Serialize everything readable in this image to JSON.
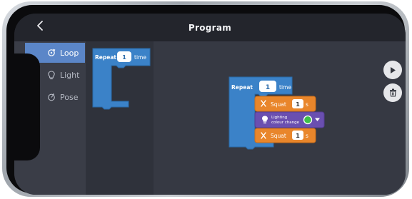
{
  "header": {
    "title": "Program",
    "back_icon": "chevron-left-icon"
  },
  "sidebar": {
    "items": [
      {
        "label": "Loop",
        "icon": "loop-icon",
        "active": true
      },
      {
        "label": "Light",
        "icon": "lightbulb-icon",
        "active": false
      },
      {
        "label": "Pose",
        "icon": "pose-icon",
        "active": false
      }
    ]
  },
  "palette": {
    "repeat_block": {
      "label": "Repeat",
      "count": "1",
      "unit": "time"
    }
  },
  "workspace": {
    "repeat_block": {
      "label": "Repeat",
      "count": "1",
      "unit": "time"
    },
    "steps": [
      {
        "label": "Squat",
        "value": "1",
        "unit": "s"
      },
      {
        "label_line1": "Lighting",
        "label_line2": "colour change",
        "color": "#3fbf4a"
      },
      {
        "label": "Squat",
        "value": "1",
        "unit": "s"
      }
    ]
  },
  "controls": {
    "play_icon": "play-icon",
    "delete_icon": "trash-icon"
  },
  "colors": {
    "loop_block": "#3b82c8",
    "action_block": "#e9862b",
    "light_block": "#6a4fb0",
    "sidebar_active": "#5b86c8"
  }
}
